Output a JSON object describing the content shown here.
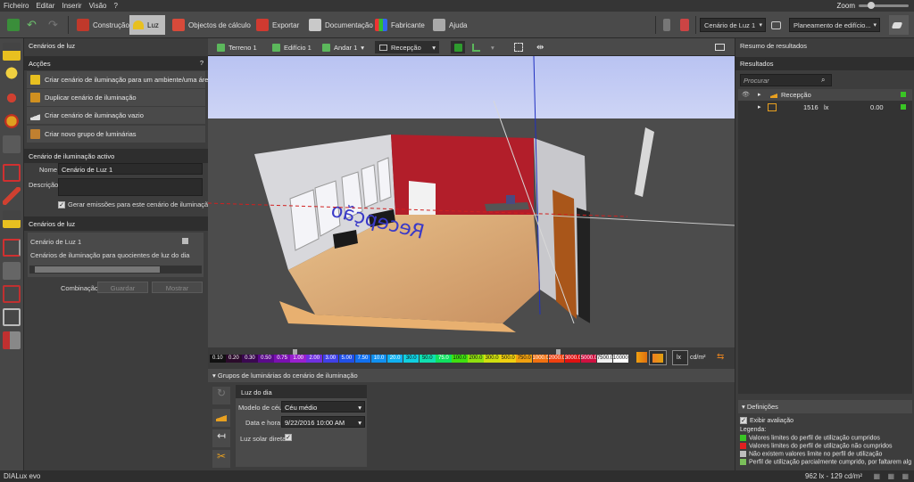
{
  "menu": [
    "Ficheiro",
    "Editar",
    "Inserir",
    "Visão",
    "?"
  ],
  "zoom_label": "Zoom",
  "toolbar": {
    "tabs": [
      "Construção",
      "Luz",
      "Objectos de cálculo",
      "Exportar",
      "Documentação",
      "Fabricante",
      "Ajuda"
    ],
    "active_tab": "Luz",
    "scene_select": "Cenário de Luz 1",
    "mode_select": "Planeamento de edifício..."
  },
  "left": {
    "scenes_title": "Cenários de luz",
    "actions_title": "Acções",
    "help": "?",
    "actions": [
      "Criar cenário de iluminação para um ambiente/uma área",
      "Duplicar cenário de iluminação",
      "Criar cenário de iluminação vazio",
      "Criar novo grupo de luminárias"
    ],
    "active_title": "Cenário de iluminação activo",
    "name_label": "Nome",
    "name_value": "Cenário de Luz 1",
    "desc_label": "Descrição",
    "desc_value": "",
    "emit_label": "Gerar emissões para este cenário de iluminação",
    "list_title": "Cenários de luz",
    "list_items": [
      "Cenário de Luz 1",
      "Cenários de iluminação para quocientes de luz do dia"
    ],
    "combo_label": "Combinação",
    "save_label": "Guardar",
    "show_label": "Mostrar"
  },
  "viewport_toolbar": {
    "terrain": "Terreno 1",
    "building": "Edifício 1",
    "floor": "Andar 1",
    "room": "Recepção"
  },
  "scene": {
    "floor_text": "Recepção"
  },
  "colorbar": {
    "values": [
      "0.10",
      "0.20",
      "0.30",
      "0.50",
      "0.75",
      "1.00",
      "2.00",
      "3.00",
      "5.00",
      "7.50",
      "10.0",
      "20.0",
      "30.0",
      "50.0",
      "75.0",
      "100.0",
      "200.0",
      "300.0",
      "500.0",
      "750.0",
      "1000.0",
      "2000.0",
      "3000.0",
      "5000.0",
      "7500.0",
      "10000.0"
    ],
    "colors": [
      "#101010",
      "#2a0a2a",
      "#3a0850",
      "#5a0a8a",
      "#7a10b0",
      "#9a20d0",
      "#7030e0",
      "#4040e8",
      "#2050e8",
      "#1070f0",
      "#1090f0",
      "#10b0f0",
      "#10d0e0",
      "#10e0b0",
      "#10e060",
      "#40e010",
      "#90e010",
      "#d0e010",
      "#f0d010",
      "#f0a010",
      "#f07010",
      "#f04010",
      "#e01010",
      "#d01040",
      "#f0f0f0",
      "#ffffff"
    ],
    "unit_lx": "lx",
    "unit_cd": "cd/m²"
  },
  "bottom": {
    "title": "Grupos de luminárias do cenário de iluminação",
    "daylight": "Luz do dia",
    "sky_label": "Modelo de céu",
    "sky_value": "Céu médio",
    "date_label": "Data e hora",
    "date_value": "9/22/2016 10:00 AM",
    "sun_label": "Luz solar direta"
  },
  "right": {
    "summary_title": "Resumo de resultados",
    "results_title": "Resultados",
    "search_placeholder": "Procurar",
    "tree_room": "Recepção",
    "tree_value": "1516",
    "tree_unit": "lx",
    "tree_value2": "0.00",
    "defs_title": "Definições",
    "show_eval": "Exibir avaliação",
    "legend_title": "Legenda:",
    "legend": [
      {
        "color": "#39c524",
        "text": "Valores limites do perfil de utilização cumpridos"
      },
      {
        "color": "#e02020",
        "text": "Valores limites do perfil de utilização não cumpridos"
      },
      {
        "color": "#bdbdbd",
        "text": "Não existem valores limite no perfil de utilização"
      },
      {
        "color": "#7abf5a",
        "text": "Perfil de utilização parcialmente cumprido, por faltarem alg"
      }
    ]
  },
  "status": {
    "brand": "DIALux evo",
    "values": "962 lx - 129 cd/m²"
  }
}
